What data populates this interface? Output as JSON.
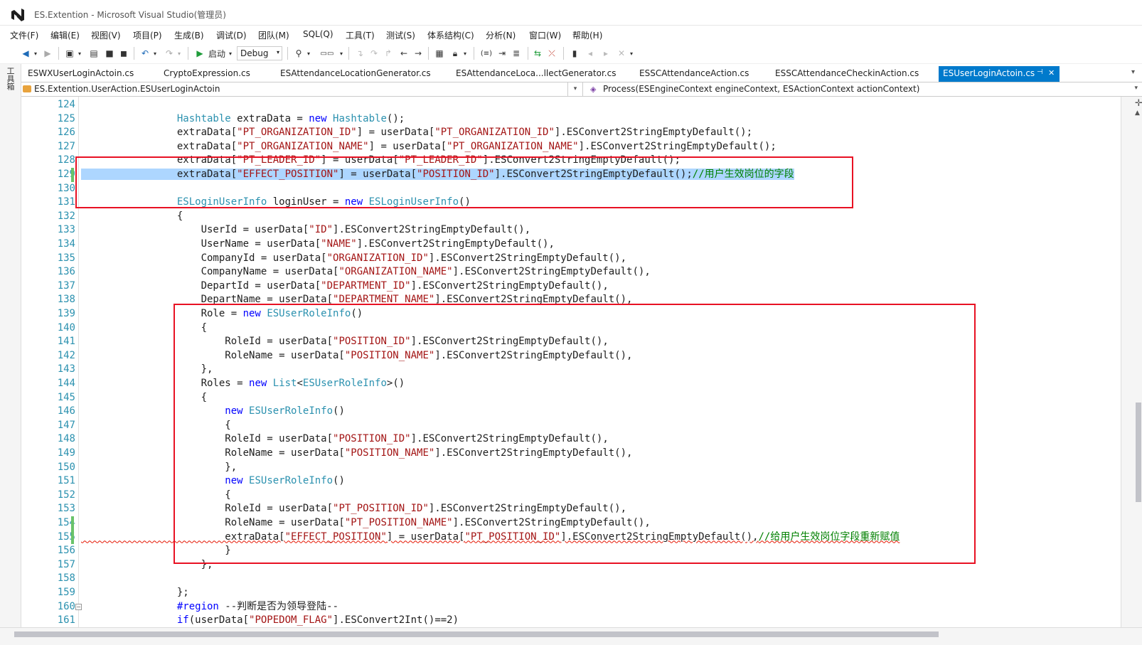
{
  "window": {
    "title": "ES.Extention - Microsoft Visual Studio(管理员)"
  },
  "menu": [
    "文件(F)",
    "编辑(E)",
    "视图(V)",
    "项目(P)",
    "生成(B)",
    "调试(D)",
    "团队(M)",
    "SQL(Q)",
    "工具(T)",
    "测试(S)",
    "体系结构(C)",
    "分析(N)",
    "窗口(W)",
    "帮助(H)"
  ],
  "toolbar": {
    "start_label": "启动",
    "config_value": "Debug"
  },
  "left_strip": {
    "label": "工具箱"
  },
  "tabs": [
    {
      "label": "ESWXUserLoginActoin.cs",
      "active": false
    },
    {
      "label": "CryptoExpression.cs",
      "active": false
    },
    {
      "label": "ESAttendanceLocationGenerator.cs",
      "active": false
    },
    {
      "label": "ESAttendanceLoca...llectGenerator.cs",
      "active": false
    },
    {
      "label": "ESSCAttendanceAction.cs",
      "active": false
    },
    {
      "label": "ESSCAttendanceCheckinAction.cs",
      "active": false
    },
    {
      "label": "ESUserLoginActoin.cs",
      "active": true
    }
  ],
  "active_tab_icons": {
    "pin": "⊣",
    "close": "✕"
  },
  "navigation": {
    "type_scope": "ES.Extention.UserAction.ESUserLoginActoin",
    "member_scope": "Process(ESEngineContext engineContext, ESActionContext actionContext)"
  },
  "editor": {
    "colors": {
      "keyword": "#0000ff",
      "type": "#2b91af",
      "string": "#a31515",
      "comment": "#008000",
      "selection": "#add6ff",
      "change_bar": "#6ac36a",
      "highlight_box": "#e81123"
    },
    "lines": [
      {
        "n": "124",
        "text": "",
        "changed": false
      },
      {
        "n": "125",
        "text": "                Hashtable extraData = new Hashtable();",
        "changed": false
      },
      {
        "n": "126",
        "text": "                extraData[\"PT_ORGANIZATION_ID\"] = userData[\"PT_ORGANIZATION_ID\"].ESConvert2StringEmptyDefault();",
        "changed": false
      },
      {
        "n": "127",
        "text": "                extraData[\"PT_ORGANIZATION_NAME\"] = userData[\"PT_ORGANIZATION_NAME\"].ESConvert2StringEmptyDefault();",
        "changed": false
      },
      {
        "n": "128",
        "text": "                extraData[\"PT_LEADER_ID\"] = userData[\"PT_LEADER_ID\"].ESConvert2StringEmptyDefault();",
        "changed": false
      },
      {
        "n": "129",
        "text": "                extraData[\"EFFECT_POSITION\"] = userData[\"POSITION_ID\"].ESConvert2StringEmptyDefault();//用户生效岗位的字段",
        "changed": true,
        "selected": true
      },
      {
        "n": "130",
        "text": "",
        "changed": false
      },
      {
        "n": "131",
        "text": "                ESLoginUserInfo loginUser = new ESLoginUserInfo()",
        "changed": false
      },
      {
        "n": "132",
        "text": "                {",
        "changed": false
      },
      {
        "n": "133",
        "text": "                    UserId = userData[\"ID\"].ESConvert2StringEmptyDefault(),",
        "changed": false
      },
      {
        "n": "134",
        "text": "                    UserName = userData[\"NAME\"].ESConvert2StringEmptyDefault(),",
        "changed": false
      },
      {
        "n": "135",
        "text": "                    CompanyId = userData[\"ORGANIZATION_ID\"].ESConvert2StringEmptyDefault(),",
        "changed": false
      },
      {
        "n": "136",
        "text": "                    CompanyName = userData[\"ORGANIZATION_NAME\"].ESConvert2StringEmptyDefault(),",
        "changed": false
      },
      {
        "n": "137",
        "text": "                    DepartId = userData[\"DEPARTMENT_ID\"].ESConvert2StringEmptyDefault(),",
        "changed": false
      },
      {
        "n": "138",
        "text": "                    DepartName = userData[\"DEPARTMENT_NAME\"].ESConvert2StringEmptyDefault(),",
        "changed": false
      },
      {
        "n": "139",
        "text": "                    Role = new ESUserRoleInfo()",
        "changed": false
      },
      {
        "n": "140",
        "text": "                    {",
        "changed": false
      },
      {
        "n": "141",
        "text": "                        RoleId = userData[\"POSITION_ID\"].ESConvert2StringEmptyDefault(),",
        "changed": false
      },
      {
        "n": "142",
        "text": "                        RoleName = userData[\"POSITION_NAME\"].ESConvert2StringEmptyDefault(),",
        "changed": false
      },
      {
        "n": "143",
        "text": "                    },",
        "changed": false
      },
      {
        "n": "144",
        "text": "                    Roles = new List<ESUserRoleInfo>()",
        "changed": false
      },
      {
        "n": "145",
        "text": "                    {",
        "changed": false
      },
      {
        "n": "146",
        "text": "                        new ESUserRoleInfo()",
        "changed": false
      },
      {
        "n": "147",
        "text": "                        {",
        "changed": false
      },
      {
        "n": "148",
        "text": "                        RoleId = userData[\"POSITION_ID\"].ESConvert2StringEmptyDefault(),",
        "changed": false
      },
      {
        "n": "149",
        "text": "                        RoleName = userData[\"POSITION_NAME\"].ESConvert2StringEmptyDefault(),",
        "changed": false
      },
      {
        "n": "150",
        "text": "                        },",
        "changed": false
      },
      {
        "n": "151",
        "text": "                        new ESUserRoleInfo()",
        "changed": false
      },
      {
        "n": "152",
        "text": "                        {",
        "changed": false
      },
      {
        "n": "153",
        "text": "                        RoleId = userData[\"PT_POSITION_ID\"].ESConvert2StringEmptyDefault(),",
        "changed": false
      },
      {
        "n": "154",
        "text": "                        RoleName = userData[\"PT_POSITION_NAME\"].ESConvert2StringEmptyDefault(),",
        "changed": true
      },
      {
        "n": "155",
        "text": "                        extraData[\"EFFECT_POSITION\"] = userData[\"PT_POSITION_ID\"].ESConvert2StringEmptyDefault(),//给用户生效岗位字段重新赋值",
        "changed": true,
        "squiggle": true
      },
      {
        "n": "156",
        "text": "                        }",
        "changed": false
      },
      {
        "n": "157",
        "text": "                    },",
        "changed": false
      },
      {
        "n": "158",
        "text": "",
        "changed": false
      },
      {
        "n": "159",
        "text": "                };",
        "changed": false
      },
      {
        "n": "160",
        "text": "                #region --判断是否为领导登陆--",
        "changed": false,
        "fold": true
      },
      {
        "n": "161",
        "text": "                if(userData[\"POPEDOM_FLAG\"].ESConvert2Int()==2)",
        "changed": false
      }
    ]
  }
}
